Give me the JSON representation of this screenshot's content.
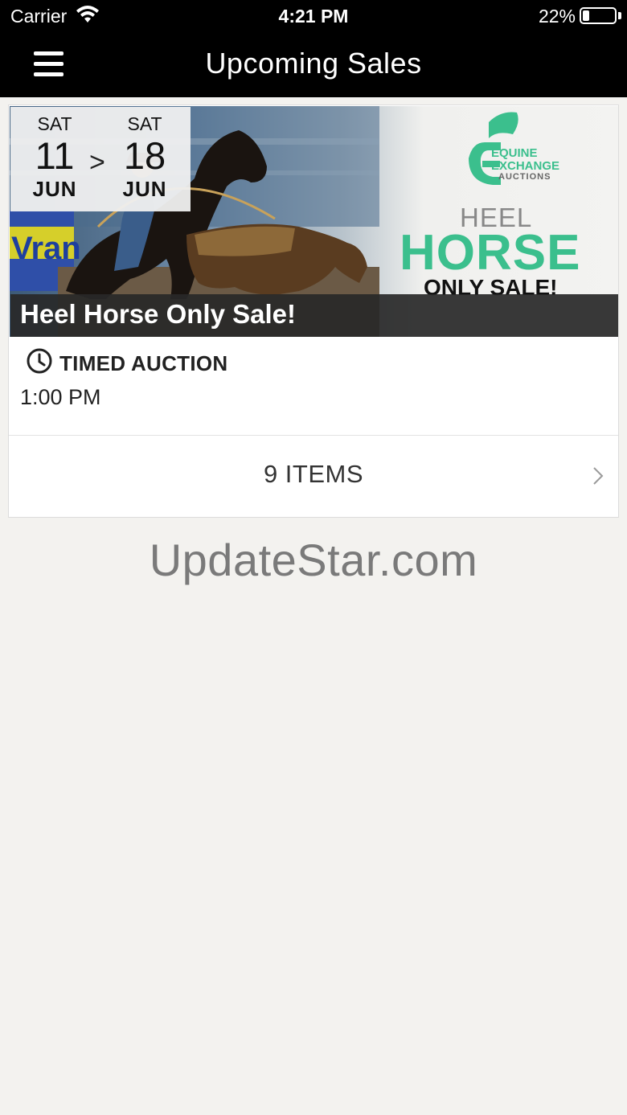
{
  "status_bar": {
    "carrier": "Carrier",
    "time": "4:21 PM",
    "battery_percent": "22%",
    "battery_level": 0.22,
    "wifi_icon": "wifi-icon",
    "battery_icon": "battery-icon"
  },
  "nav": {
    "title": "Upcoming Sales",
    "menu_icon": "hamburger-menu-icon"
  },
  "sale": {
    "start": {
      "dow": "SAT",
      "day": "11",
      "month": "JUN"
    },
    "end": {
      "dow": "SAT",
      "day": "18",
      "month": "JUN"
    },
    "date_separator": ">",
    "banner": {
      "brand_line1": "EQUINE",
      "brand_line2": "EXCHANGE",
      "brand_line3": "AUCTIONS",
      "headline_small": "HEEL",
      "headline_big": "HORSE",
      "headline_sub": "ONLY SALE!"
    },
    "title": "Heel Horse Only Sale!",
    "auction_type": "TIMED AUCTION",
    "time": "1:00 PM",
    "items_label": "9 ITEMS",
    "clock_icon": "clock-icon",
    "chevron_icon": "chevron-right-icon"
  },
  "colors": {
    "brand_green": "#3bbf8d",
    "nav_bg": "#000000",
    "page_bg": "#f3f2ef"
  },
  "watermark": "UpdateStar.com"
}
